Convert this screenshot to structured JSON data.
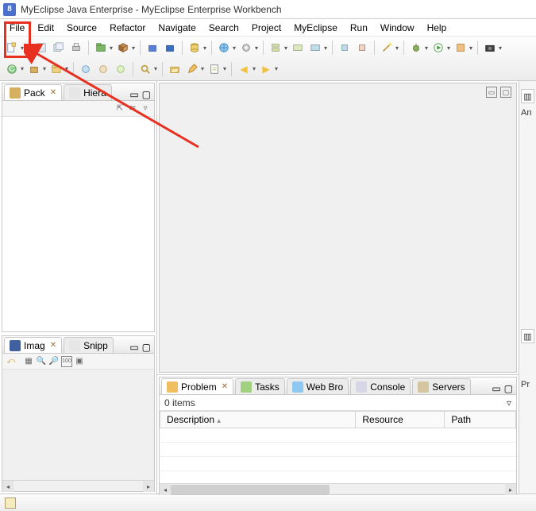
{
  "title": "MyEclipse Java Enterprise - MyEclipse Enterprise Workbench",
  "menus": [
    "File",
    "Edit",
    "Source",
    "Refactor",
    "Navigate",
    "Search",
    "Project",
    "MyEclipse",
    "Run",
    "Window",
    "Help"
  ],
  "left_views": {
    "pack_tab": "Pack",
    "hiera_tab": "Hiera",
    "imag_tab": "Imag",
    "snipp_tab": "Snipp"
  },
  "right_stubs": {
    "an": "An",
    "pr": "Pr"
  },
  "bottom": {
    "tabs": [
      "Problem",
      "Tasks",
      "Web Bro",
      "Console",
      "Servers"
    ],
    "items_label": "0 items",
    "columns": [
      "Description",
      "Resource",
      "Path"
    ]
  },
  "colors": {
    "highlight": "#e83020"
  }
}
